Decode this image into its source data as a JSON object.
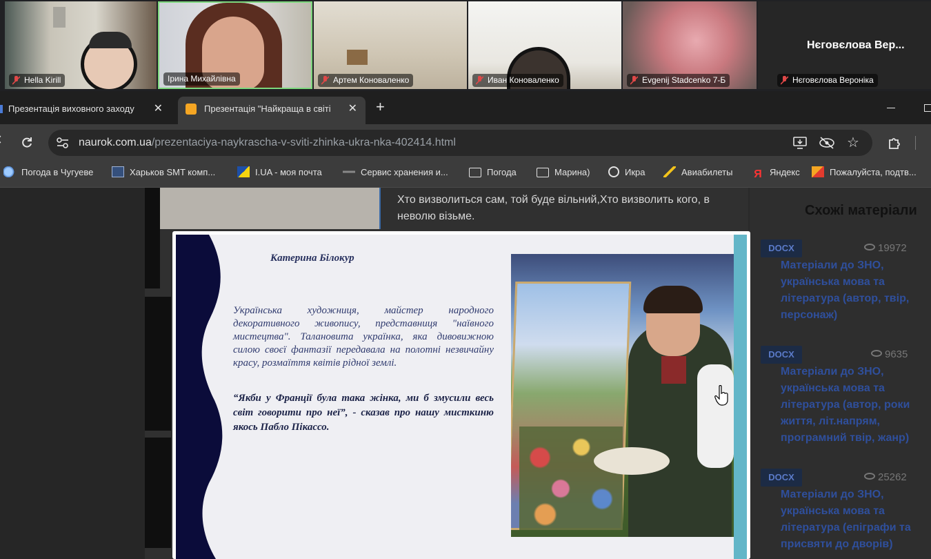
{
  "call": {
    "participants": [
      {
        "name": "Hella Kirill",
        "muted": true
      },
      {
        "name": "Ірина Михайлівна",
        "muted": false,
        "active": true
      },
      {
        "name": "Артем Коноваленко",
        "muted": true
      },
      {
        "name": "Иван Коноваленко",
        "muted": true
      },
      {
        "name": "Evgenij Stadcenko 7-Б",
        "muted": true
      },
      {
        "name": "Нєговєлова Вероніка",
        "muted": true
      }
    ],
    "tile_big_name": "Нєговєлова Вер..."
  },
  "browser": {
    "tabs": [
      {
        "label": "Презентація виховного заходу",
        "active": false
      },
      {
        "label": "Презентація \"Найкраща в світі",
        "active": true
      }
    ],
    "new_tab": "+",
    "url_host": "naurok.com.ua",
    "url_path": "/prezentaciya-naykrascha-v-sviti-zhinka-ukra-nka-402414.html",
    "bookmarks": [
      {
        "label": "Погода в Чугуеве",
        "icon": "weather-icon"
      },
      {
        "label": "Харьков SMT комп...",
        "icon": "smt-icon"
      },
      {
        "label": "I.UA - моя почта",
        "icon": "iua-icon"
      },
      {
        "label": "Сервис хранения и...",
        "icon": "storage-icon"
      },
      {
        "label": "Погода",
        "icon": "folder-icon"
      },
      {
        "label": "Марина)",
        "icon": "folder-icon"
      },
      {
        "label": "Икра",
        "icon": "globe-icon"
      },
      {
        "label": "Авиабилеты",
        "icon": "plane-icon"
      },
      {
        "label": "Яндекс",
        "icon": "yandex-icon"
      },
      {
        "label": "Пожалуйста, подтв...",
        "icon": "warn-icon"
      }
    ]
  },
  "page": {
    "quote": "Хто визволиться сам, той буде вільний,Хто визволить кого, в неволю візьме.",
    "similar_title": "Схожі матеріали",
    "similar": [
      {
        "badge": "DOCX",
        "views": "19972",
        "title": "Матеріали до ЗНО, українська мова та література (автор, твір, персонаж)"
      },
      {
        "badge": "DOCX",
        "views": "9635",
        "title": "Матеріали до ЗНО, українська мова та література (автор, роки життя, літ.напрям, програмний твір, жанр)"
      },
      {
        "badge": "DOCX",
        "views": "25262",
        "title": "Матеріали до ЗНО, українська мова та література (епіграфи та присвяти до дворів)"
      }
    ]
  },
  "slide": {
    "author": "Катерина Білокур",
    "body": "Українська художниця, майстер народного декоративного живопису, представниця \"наївного мистецтва\". Талановита українка, яка дивовижною силою своєї фантазії передавала на полотні незвичайну красу, розмаїття квітів рідної землі.",
    "quote": "“Якби у Франції була така жінка, ми б змусили весь світ говорити про неї”, - сказав про нашу мисткиню якось Пабло Пікассо."
  },
  "colors": {
    "accent_blue": "#2f4f9c",
    "slide_navy": "#0b0c3a",
    "slide_teal": "#63b6c8",
    "active_tile_border": "#7dd87d"
  }
}
